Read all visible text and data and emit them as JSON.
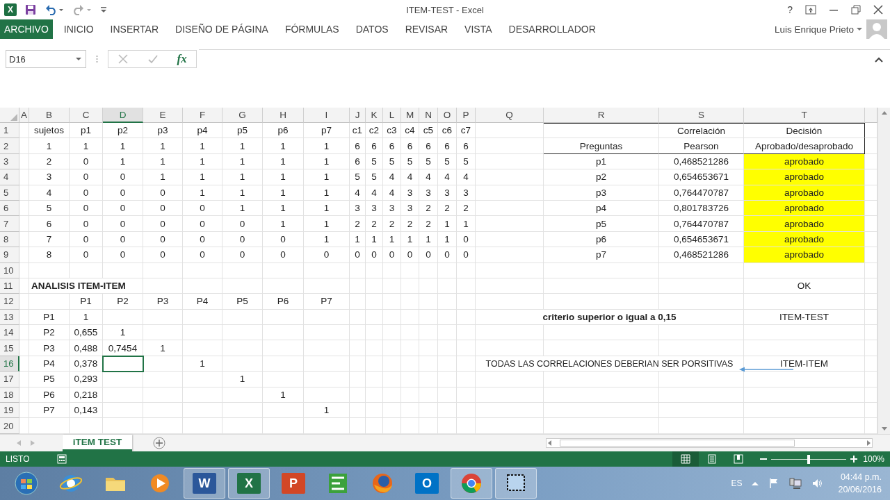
{
  "window": {
    "title": "ITEM-TEST - Excel",
    "app_glyph": "X",
    "help": "?",
    "user": "Luis Enrique Prieto"
  },
  "ribbon": {
    "tabs": [
      {
        "label": "ARCHIVO",
        "kind": "file"
      },
      {
        "label": "INICIO",
        "kind": "tab"
      },
      {
        "label": "INSERTAR",
        "kind": "tab"
      },
      {
        "label": "DISEÑO DE PÁGINA",
        "kind": "tab"
      },
      {
        "label": "FÓRMULAS",
        "kind": "tab"
      },
      {
        "label": "DATOS",
        "kind": "tab"
      },
      {
        "label": "REVISAR",
        "kind": "tab"
      },
      {
        "label": "VISTA",
        "kind": "tab"
      },
      {
        "label": "DESARROLLADOR",
        "kind": "tab"
      }
    ]
  },
  "formula_bar": {
    "name_box": "D16",
    "function_label": "fx"
  },
  "sheet": {
    "columns": [
      {
        "label": "A",
        "selected": false
      },
      {
        "label": "B",
        "selected": false
      },
      {
        "label": "C",
        "selected": false
      },
      {
        "label": "D",
        "selected": true
      },
      {
        "label": "E",
        "selected": false
      },
      {
        "label": "F",
        "selected": false
      },
      {
        "label": "G",
        "selected": false
      },
      {
        "label": "H",
        "selected": false
      },
      {
        "label": "I",
        "selected": false
      },
      {
        "label": "J",
        "selected": false
      },
      {
        "label": "K",
        "selected": false
      },
      {
        "label": "L",
        "selected": false
      },
      {
        "label": "M",
        "selected": false
      },
      {
        "label": "N",
        "selected": false
      },
      {
        "label": "O",
        "selected": false
      },
      {
        "label": "P",
        "selected": false
      },
      {
        "label": "Q",
        "selected": false
      },
      {
        "label": "R",
        "selected": false
      },
      {
        "label": "S",
        "selected": false
      },
      {
        "label": "T",
        "selected": false
      }
    ],
    "rows": [
      {
        "number": "1",
        "selected": false,
        "cells": [
          null,
          "sujetos",
          "p1",
          "p2",
          "p3",
          "p4",
          "p5",
          "p6",
          "p7",
          "c1",
          "c2",
          "c3",
          "c4",
          "c5",
          "c6",
          "c7",
          null,
          {
            "border_top": true
          },
          {
            "text": "Correlación",
            "border_top": true
          },
          {
            "text": "Decisión",
            "border_top": true,
            "border_right": true
          }
        ]
      },
      {
        "number": "2",
        "selected": false,
        "cells": [
          null,
          "1",
          "1",
          "1",
          "1",
          "1",
          "1",
          "1",
          "1",
          "6",
          "6",
          "6",
          "6",
          "6",
          "6",
          "6",
          null,
          {
            "text": "Preguntas",
            "border_bottom": true
          },
          {
            "text": "Pearson",
            "border_bottom": true
          },
          {
            "text": "Aprobado/desaprobado",
            "border_bottom": true,
            "border_right": true
          }
        ]
      },
      {
        "number": "3",
        "selected": false,
        "cells": [
          null,
          "2",
          "0",
          "1",
          "1",
          "1",
          "1",
          "1",
          "1",
          "6",
          "5",
          "5",
          "5",
          "5",
          "5",
          "5",
          null,
          "p1",
          "0,468521286",
          {
            "text": "aprobado",
            "color": "#ffff00"
          }
        ]
      },
      {
        "number": "4",
        "selected": false,
        "cells": [
          null,
          "3",
          "0",
          "0",
          "1",
          "1",
          "1",
          "1",
          "1",
          "5",
          "5",
          "4",
          "4",
          "4",
          "4",
          "4",
          null,
          "p2",
          "0,654653671",
          {
            "text": "aprobado",
            "color": "#ffff00"
          }
        ]
      },
      {
        "number": "5",
        "selected": false,
        "cells": [
          null,
          "4",
          "0",
          "0",
          "0",
          "1",
          "1",
          "1",
          "1",
          "4",
          "4",
          "4",
          "3",
          "3",
          "3",
          "3",
          null,
          "p3",
          "0,764470787",
          {
            "text": "aprobado",
            "color": "#ffff00"
          }
        ]
      },
      {
        "number": "6",
        "selected": false,
        "cells": [
          null,
          "5",
          "0",
          "0",
          "0",
          "0",
          "1",
          "1",
          "1",
          "3",
          "3",
          "3",
          "3",
          "2",
          "2",
          "2",
          null,
          "p4",
          "0,801783726",
          {
            "text": "aprobado",
            "color": "#ffff00"
          }
        ]
      },
      {
        "number": "7",
        "selected": false,
        "cells": [
          null,
          "6",
          "0",
          "0",
          "0",
          "0",
          "0",
          "1",
          "1",
          "2",
          "2",
          "2",
          "2",
          "2",
          "1",
          "1",
          null,
          "p5",
          "0,764470787",
          {
            "text": "aprobado",
            "color": "#ffff00"
          }
        ]
      },
      {
        "number": "8",
        "selected": false,
        "cells": [
          null,
          "7",
          "0",
          "0",
          "0",
          "0",
          "0",
          "0",
          "1",
          "1",
          "1",
          "1",
          "1",
          "1",
          "1",
          "0",
          null,
          "p6",
          "0,654653671",
          {
            "text": "aprobado",
            "color": "#ffff00"
          }
        ]
      },
      {
        "number": "9",
        "selected": false,
        "cells": [
          null,
          "8",
          "0",
          "0",
          "0",
          "0",
          "0",
          "0",
          "0",
          "0",
          "0",
          "0",
          "0",
          "0",
          "0",
          "0",
          null,
          "p7",
          "0,468521286",
          {
            "text": "aprobado",
            "color": "#ffff00"
          }
        ]
      },
      {
        "number": "10",
        "selected": false,
        "cells": []
      },
      {
        "number": "11",
        "selected": false,
        "cells": [
          null,
          {
            "text": "ANALISIS ITEM-ITEM",
            "bold": true,
            "left_aligned": true,
            "overflow": true
          },
          null,
          null,
          null,
          null,
          null,
          null,
          null,
          null,
          null,
          null,
          null,
          null,
          null,
          null,
          null,
          null,
          null,
          "OK"
        ]
      },
      {
        "number": "12",
        "selected": false,
        "cells": [
          null,
          null,
          "P1",
          "P2",
          "P3",
          "P4",
          "P5",
          "P6",
          "P7"
        ]
      },
      {
        "number": "13",
        "selected": false,
        "cells": [
          null,
          "P1",
          "1",
          null,
          null,
          null,
          null,
          null,
          null,
          null,
          null,
          null,
          null,
          null,
          null,
          null,
          null,
          {
            "text": "criterio superior o igual a 0,15",
            "bold": true,
            "overflow": true
          },
          null,
          "ITEM-TEST"
        ]
      },
      {
        "number": "14",
        "selected": false,
        "cells": [
          null,
          "P2",
          "0,655",
          "1"
        ]
      },
      {
        "number": "15",
        "selected": false,
        "cells": [
          null,
          "P3",
          "0,488",
          "0,7454",
          "1"
        ]
      },
      {
        "number": "16",
        "selected": true,
        "cells": [
          null,
          "P4",
          "0,378",
          null,
          null,
          "1",
          null,
          null,
          null,
          null,
          null,
          null,
          null,
          null,
          null,
          null,
          null,
          {
            "text": "TODAS LAS CORRELACIONES DEBERIAN SER PORSITIVAS",
            "overflow": true
          },
          null,
          "ITEM-ITEM"
        ]
      },
      {
        "number": "17",
        "selected": false,
        "cells": [
          null,
          "P5",
          "0,293",
          null,
          null,
          null,
          "1"
        ]
      },
      {
        "number": "18",
        "selected": false,
        "cells": [
          null,
          "P6",
          "0,218",
          null,
          null,
          null,
          null,
          "1"
        ]
      },
      {
        "number": "19",
        "selected": false,
        "cells": [
          null,
          "P7",
          "0,143",
          null,
          null,
          null,
          null,
          null,
          "1"
        ]
      },
      {
        "number": "20",
        "selected": false,
        "cells": []
      }
    ],
    "shapes": [
      {
        "kind": "arrow"
      }
    ]
  },
  "sheet_tabs": [
    {
      "label": "iTEM TEST",
      "selected": true
    }
  ],
  "status_bar": {
    "status": "LISTO",
    "views": [
      {
        "kind": "normal",
        "selected": true
      },
      {
        "kind": "page-layout",
        "selected": false
      },
      {
        "kind": "page-break",
        "selected": false
      }
    ],
    "zoom": {
      "level": 0.5,
      "reading": "100%"
    }
  },
  "taskbar": {
    "apps": [
      {
        "kind": "start",
        "running": false
      },
      {
        "kind": "browser-e",
        "running": false
      },
      {
        "kind": "folder",
        "running": false
      },
      {
        "kind": "media",
        "running": false
      },
      {
        "kind": "word",
        "glyph": "W",
        "running": true
      },
      {
        "kind": "excel",
        "glyph": "X",
        "running": true
      },
      {
        "kind": "powerpoint",
        "glyph": "P",
        "running": false
      },
      {
        "kind": "project",
        "running": false
      },
      {
        "kind": "firefox",
        "running": false
      },
      {
        "kind": "outlook",
        "glyph": "O",
        "running": false
      },
      {
        "kind": "chrome",
        "running": true
      },
      {
        "kind": "snip",
        "running": true
      }
    ],
    "tray": {
      "language": "ES",
      "time": "04:44 p.m.",
      "date": "20/06/2016"
    }
  }
}
